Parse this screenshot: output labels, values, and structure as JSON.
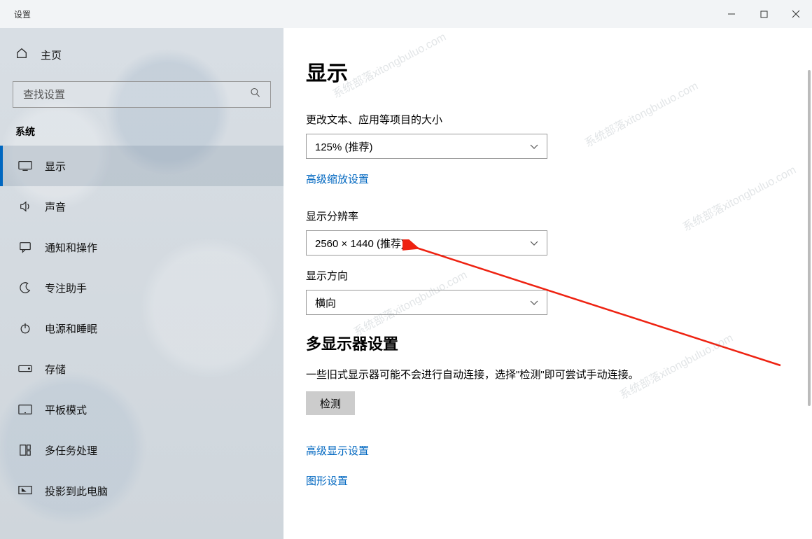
{
  "window": {
    "title": "设置"
  },
  "sidebar": {
    "home": "主页",
    "search_placeholder": "查找设置",
    "category": "系统",
    "items": [
      {
        "label": "显示"
      },
      {
        "label": "声音"
      },
      {
        "label": "通知和操作"
      },
      {
        "label": "专注助手"
      },
      {
        "label": "电源和睡眠"
      },
      {
        "label": "存储"
      },
      {
        "label": "平板模式"
      },
      {
        "label": "多任务处理"
      },
      {
        "label": "投影到此电脑"
      }
    ],
    "active_index": 0
  },
  "content": {
    "heading": "显示",
    "scale_label": "更改文本、应用等项目的大小",
    "scale_value": "125% (推荐)",
    "advanced_scale_link": "高级缩放设置",
    "resolution_label": "显示分辨率",
    "resolution_value": "2560 × 1440 (推荐)",
    "orientation_label": "显示方向",
    "orientation_value": "横向",
    "multi_heading": "多显示器设置",
    "multi_desc": "一些旧式显示器可能不会进行自动连接，选择\"检测\"即可尝试手动连接。",
    "detect_btn": "检测",
    "advanced_display_link": "高级显示设置",
    "graphics_link": "图形设置"
  },
  "watermark": "系统部落xitongbuluo.com",
  "colors": {
    "accent": "#0067c0",
    "link": "#0067c0"
  }
}
